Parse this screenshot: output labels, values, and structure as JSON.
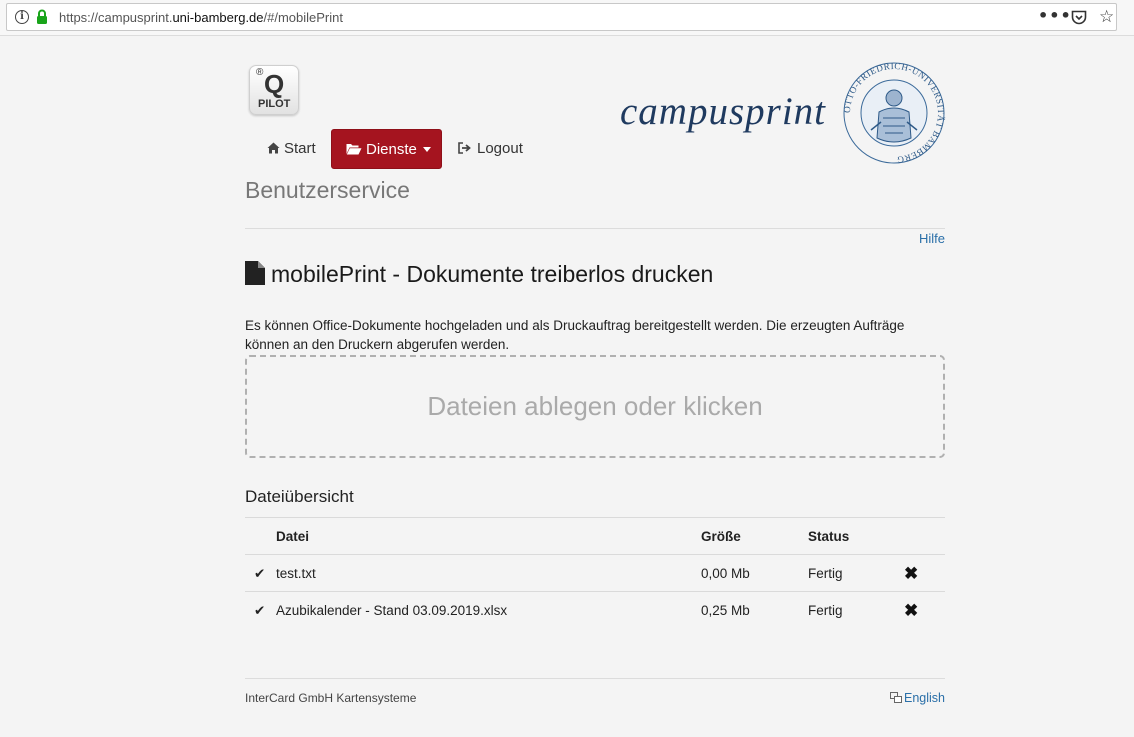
{
  "browser": {
    "url_prefix": "https://campusprint.",
    "url_domain": "uni-bamberg.de",
    "url_suffix": "/#/mobilePrint",
    "icons": [
      "info-icon",
      "lock-icon",
      "more-icon",
      "pocket-icon",
      "star-icon"
    ]
  },
  "logos": {
    "qpilot_reg": "®",
    "qpilot_q": "Q",
    "qpilot_pilot": "PILOT",
    "campusprint": "campusprint",
    "seal_text": "OTTO-FRIEDRICH-UNIVERSITÄT BAMBERG"
  },
  "nav": {
    "start": "Start",
    "dienste": "Dienste",
    "logout": "Logout"
  },
  "section_title": "Benutzerservice",
  "help_link": "Hilfe",
  "page_heading": "mobilePrint - Dokumente treiberlos drucken",
  "intro": "Es können Office-Dokumente hochgeladen und als Druckauftrag bereitgestellt werden. Die erzeugten Aufträge können an den Druckern abgerufen werden.",
  "dropzone": "Dateien ablegen oder klicken",
  "files_title": "Dateiübersicht",
  "table": {
    "headers": {
      "name": "Datei",
      "size": "Größe",
      "status": "Status"
    },
    "rows": [
      {
        "check": "✔",
        "name": "test.txt",
        "size": "0,00 Mb",
        "status": "Fertig",
        "delete": "✖"
      },
      {
        "check": "✔",
        "name": "Azubikalender - Stand 03.09.2019.xlsx",
        "size": "0,25 Mb",
        "status": "Fertig",
        "delete": "✖"
      }
    ]
  },
  "footer": {
    "company": "InterCard GmbH Kartensysteme",
    "language": "English"
  },
  "colors": {
    "accent_red": "#a5141f",
    "link_blue": "#2a6fa8",
    "campus_blue": "#1f3a5f"
  }
}
